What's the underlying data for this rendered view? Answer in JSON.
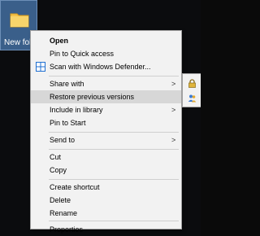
{
  "desktop": {
    "folder_label": "New fol",
    "folder_icon": "folder-icon"
  },
  "context_menu": {
    "items": {
      "open": "Open",
      "pin_quick_access": "Pin to Quick access",
      "scan_defender": "Scan with Windows Defender...",
      "share_with": "Share with",
      "restore_versions": "Restore previous versions",
      "include_library": "Include in library",
      "pin_start": "Pin to Start",
      "send_to": "Send to",
      "cut": "Cut",
      "copy": "Copy",
      "create_shortcut": "Create shortcut",
      "delete": "Delete",
      "rename": "Rename",
      "properties": "Properties"
    },
    "arrow_glyph": ">",
    "highlighted_item": "Restore previous versions",
    "colors": {
      "menu_bg": "#f2f2f2",
      "highlight_bg": "#d7d7d7",
      "defender_blue": "#1f6fd1"
    }
  },
  "submenu": {
    "icons": [
      "lock-icon",
      "users-icon"
    ]
  }
}
